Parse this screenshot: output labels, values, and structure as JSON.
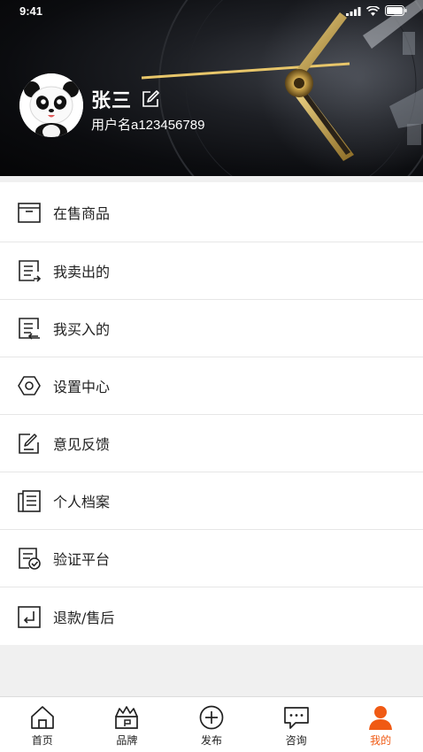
{
  "status_bar": {
    "time": "9:41"
  },
  "profile": {
    "name": "张三",
    "username": "用户名a123456789"
  },
  "menu": [
    {
      "label": "在售商品",
      "icon": "box-icon"
    },
    {
      "label": "我卖出的",
      "icon": "sold-list-icon"
    },
    {
      "label": "我买入的",
      "icon": "bought-list-icon"
    },
    {
      "label": "设置中心",
      "icon": "settings-hex-icon"
    },
    {
      "label": "意见反馈",
      "icon": "feedback-edit-icon"
    },
    {
      "label": "个人档案",
      "icon": "profile-document-icon"
    },
    {
      "label": "验证平台",
      "icon": "verify-document-icon"
    },
    {
      "label": "退款/售后",
      "icon": "refund-icon"
    }
  ],
  "tabbar": {
    "items": [
      {
        "label": "首页",
        "icon": "home-icon",
        "active": false
      },
      {
        "label": "品牌",
        "icon": "brand-crown-icon",
        "active": false
      },
      {
        "label": "发布",
        "icon": "publish-plus-icon",
        "active": false
      },
      {
        "label": "咨询",
        "icon": "chat-icon",
        "active": false
      },
      {
        "label": "我的",
        "icon": "user-icon",
        "active": true
      }
    ],
    "active_color": "#f05a14"
  }
}
